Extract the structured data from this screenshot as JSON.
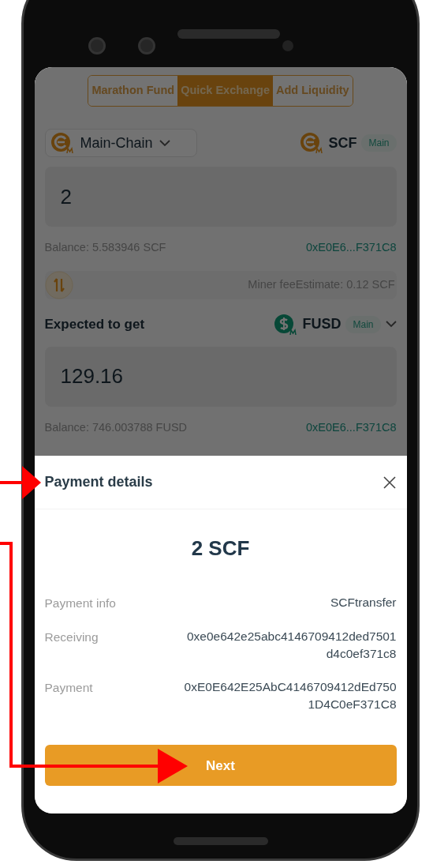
{
  "tabs": [
    {
      "label": "Marathon Fund",
      "selected": false
    },
    {
      "label": "Quick Exchange",
      "selected": true
    },
    {
      "label": "Add Liquidity",
      "selected": false
    }
  ],
  "from": {
    "chain": "Main-Chain",
    "token": "SCF",
    "badge": "Main",
    "amount": "2",
    "balance": "Balance: 5.583946 SCF",
    "address": "0xE0E6...F371C8"
  },
  "miner_fee": "Miner feeEstimate: 0.12 SCF",
  "to": {
    "label": "Expected to get",
    "token": "FUSD",
    "badge": "Main",
    "amount": "129.16",
    "balance": "Balance: 746.003788 FUSD",
    "address": "0xE0E6...F371C8"
  },
  "sheet": {
    "title": "Payment details",
    "amount": "2 SCF",
    "rows": [
      {
        "label": "Payment info",
        "value": "SCFtransfer"
      },
      {
        "label": "Receiving",
        "value": "0xe0e642e25abc4146709412ded7501d4c0ef371c8"
      },
      {
        "label": "Payment",
        "value": "0xE0E642E25AbC4146709412dEd7501D4C0eF371C8"
      }
    ],
    "button": "Next"
  }
}
